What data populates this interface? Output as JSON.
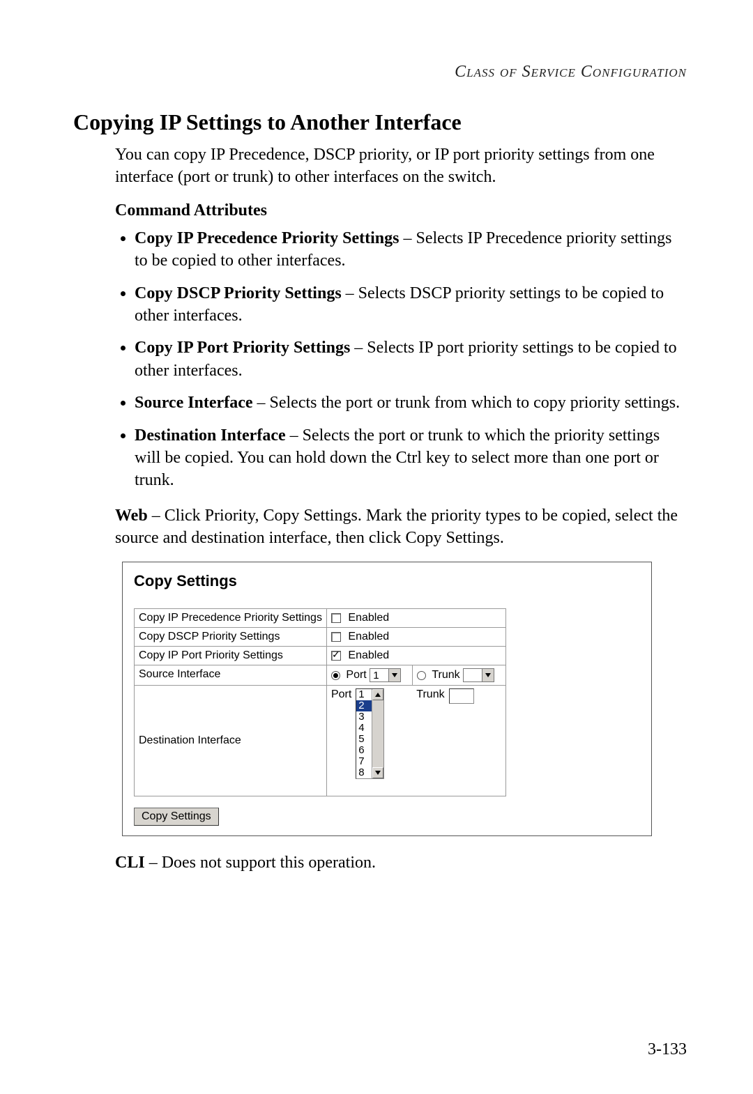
{
  "running_head": "Class of Service Configuration",
  "section_title": "Copying IP Settings to Another Interface",
  "intro": "You can copy IP Precedence, DSCP priority, or IP port priority settings from one interface (port or trunk) to other interfaces on the switch.",
  "sub_heading": "Command Attributes",
  "bullets": [
    {
      "term": "Copy IP Precedence Priority Settings",
      "desc": " – Selects IP Precedence priority settings to be copied to other interfaces."
    },
    {
      "term": "Copy DSCP Priority Settings",
      "desc": " – Selects DSCP priority settings to be copied to other interfaces."
    },
    {
      "term": "Copy IP Port Priority Settings",
      "desc": " – Selects IP port priority settings to be copied to other interfaces."
    },
    {
      "term": "Source Interface",
      "desc": " – Selects the port or trunk from which to copy priority settings."
    },
    {
      "term": "Destination Interface",
      "desc": " – Selects the port or trunk to which the priority settings will be copied. You can hold down the Ctrl key to select more than one port or trunk."
    }
  ],
  "web_label": "Web",
  "web_text": " – Click Priority, Copy Settings. Mark the priority types to be copied, select the source and destination interface, then click Copy Settings.",
  "figure": {
    "title": "Copy Settings",
    "rows": {
      "ip_prec": {
        "label": "Copy IP Precedence Priority Settings",
        "enabled_label": "Enabled",
        "checked": false
      },
      "dscp": {
        "label": "Copy DSCP Priority Settings",
        "enabled_label": "Enabled",
        "checked": false
      },
      "ip_port": {
        "label": "Copy IP Port Priority Settings",
        "enabled_label": "Enabled",
        "checked": true
      },
      "source": {
        "label": "Source Interface",
        "port_label": "Port",
        "port_value": "1",
        "port_selected": true,
        "trunk_label": "Trunk",
        "trunk_value": "",
        "trunk_selected": false
      },
      "dest": {
        "label": "Destination Interface",
        "port_label": "Port",
        "port_items": [
          "1",
          "2",
          "3",
          "4",
          "5",
          "6",
          "7",
          "8"
        ],
        "port_selected_index": 1,
        "trunk_label": "Trunk"
      }
    },
    "button": "Copy Settings"
  },
  "cli_label": "CLI",
  "cli_text": " – Does not support this operation.",
  "page_number": "3-133"
}
